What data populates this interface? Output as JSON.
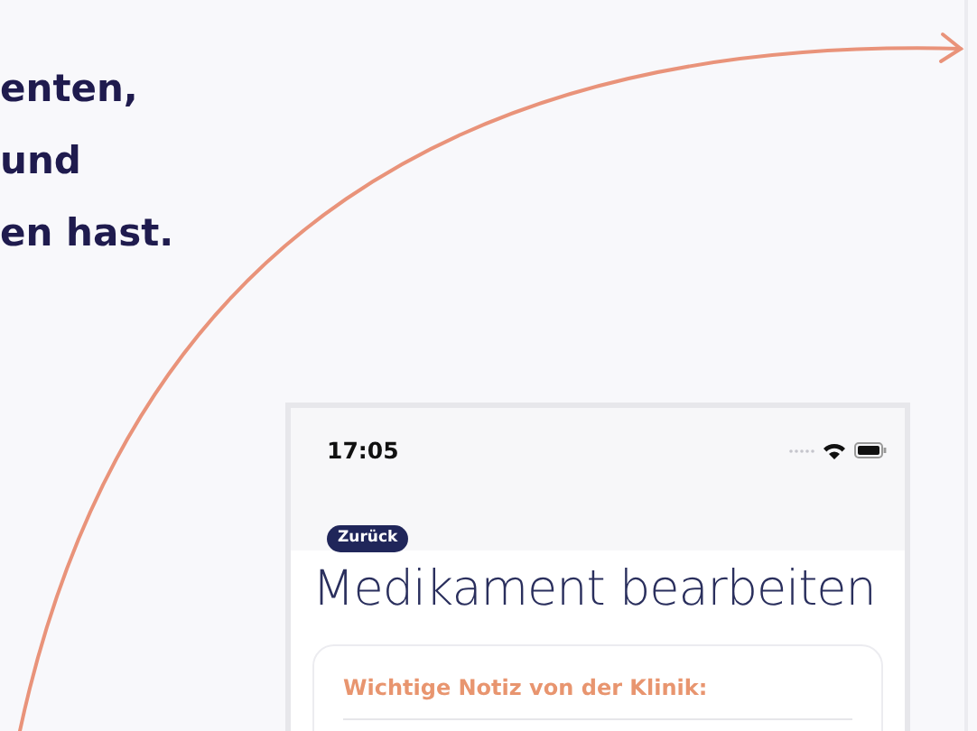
{
  "intro_lines": [
    "enten,",
    "und",
    "en hast."
  ],
  "phone": {
    "status_time": "17:05",
    "back_button": "Zurück",
    "title": "Medikament bearbeiten",
    "note_card": {
      "heading": "Wichtige Notiz von der Klinik:"
    }
  }
}
